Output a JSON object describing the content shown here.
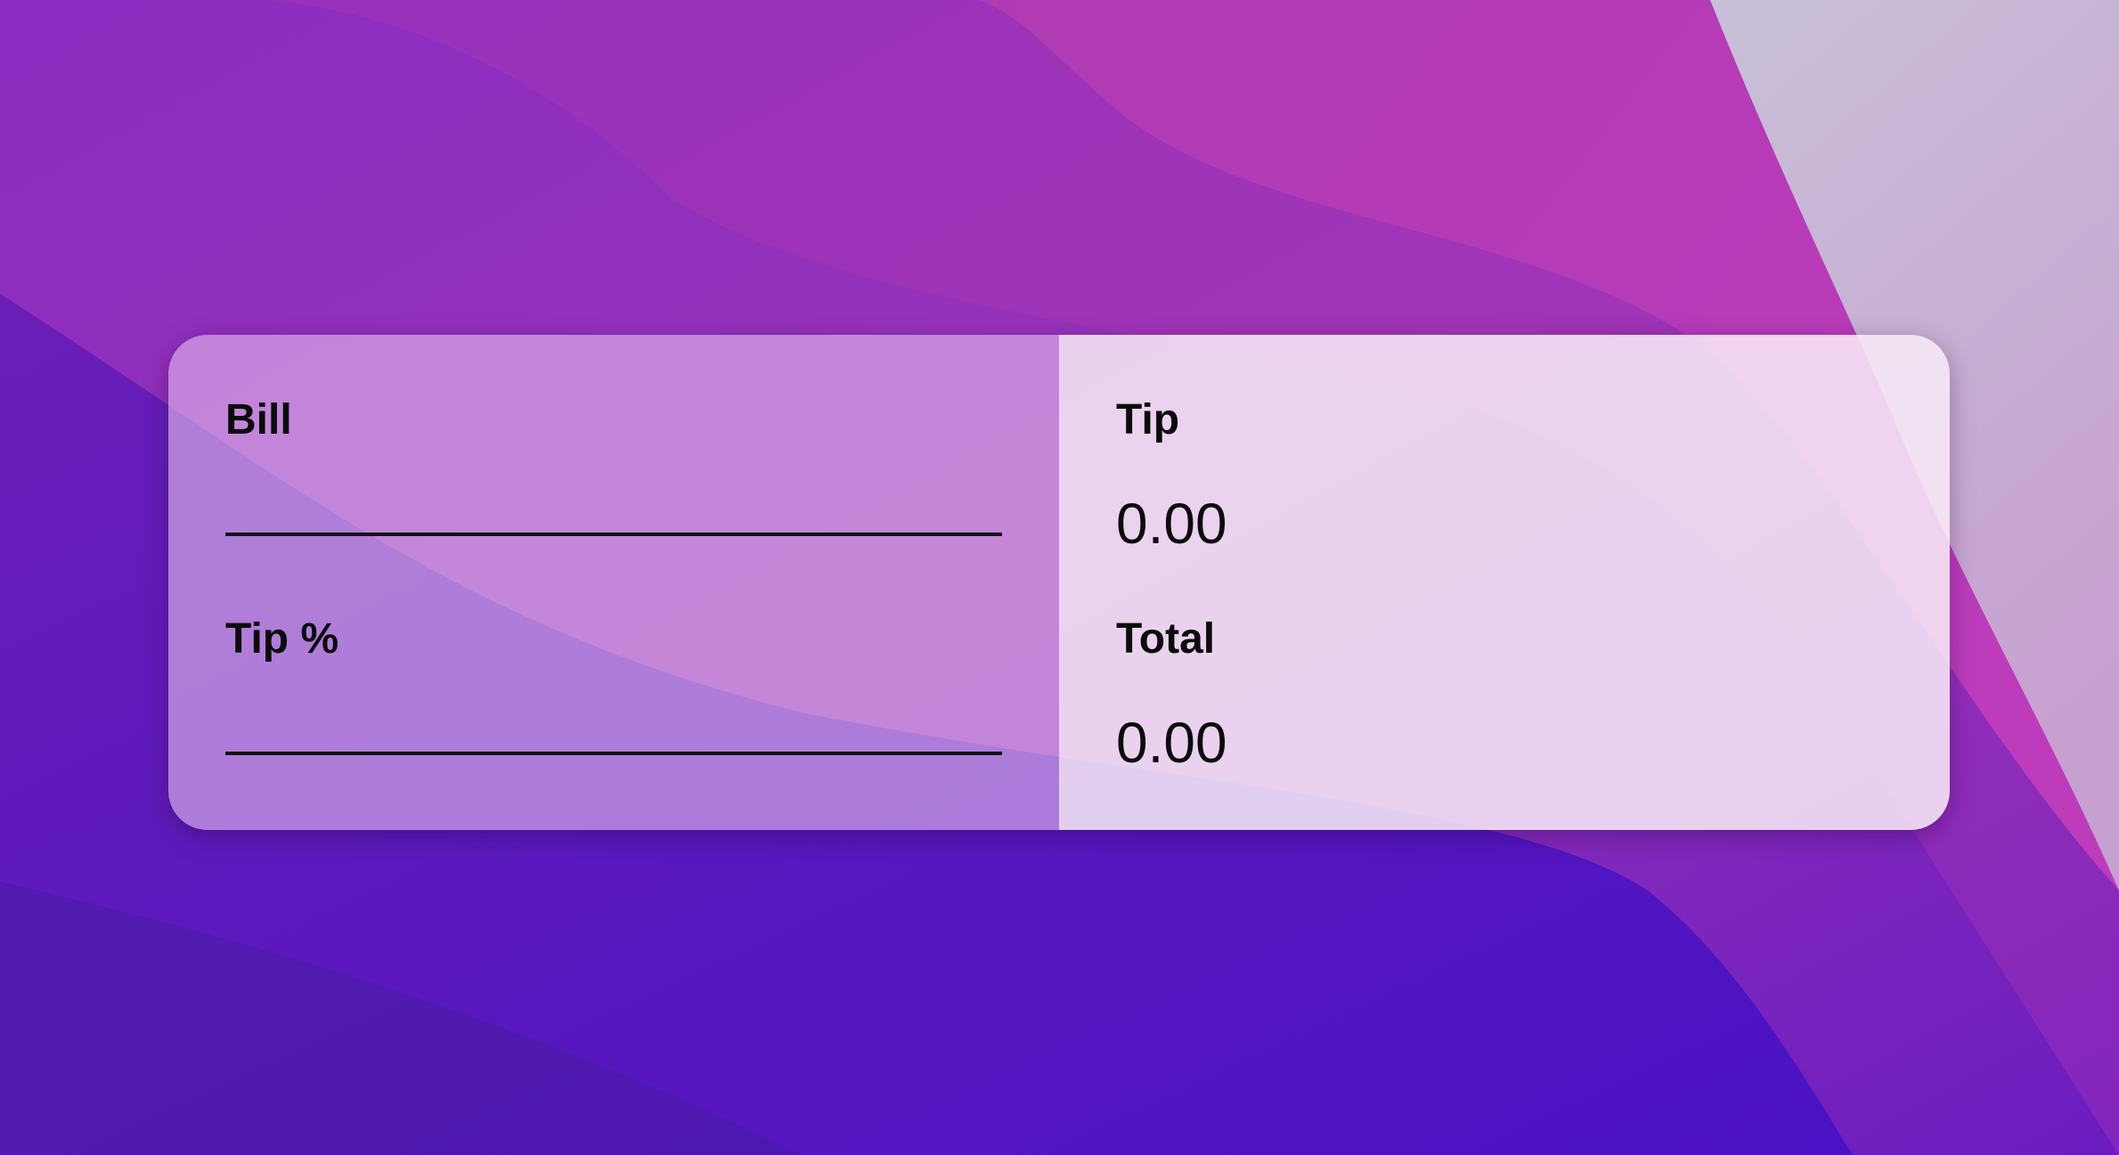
{
  "calculator": {
    "bill": {
      "label": "Bill",
      "value": "",
      "placeholder": ""
    },
    "tip_percent": {
      "label": "Tip %",
      "value": "",
      "placeholder": ""
    },
    "tip": {
      "label": "Tip",
      "value": "0.00"
    },
    "total": {
      "label": "Total",
      "value": "0.00"
    }
  },
  "colors": {
    "wallpaper_primary": "#7a22b8",
    "wallpaper_magenta": "#c03ab8",
    "wallpaper_indigo": "#5616c4",
    "input_pane": "#d8a8e2",
    "output_pane": "#f1dff1",
    "text": "#0b0b0b"
  }
}
